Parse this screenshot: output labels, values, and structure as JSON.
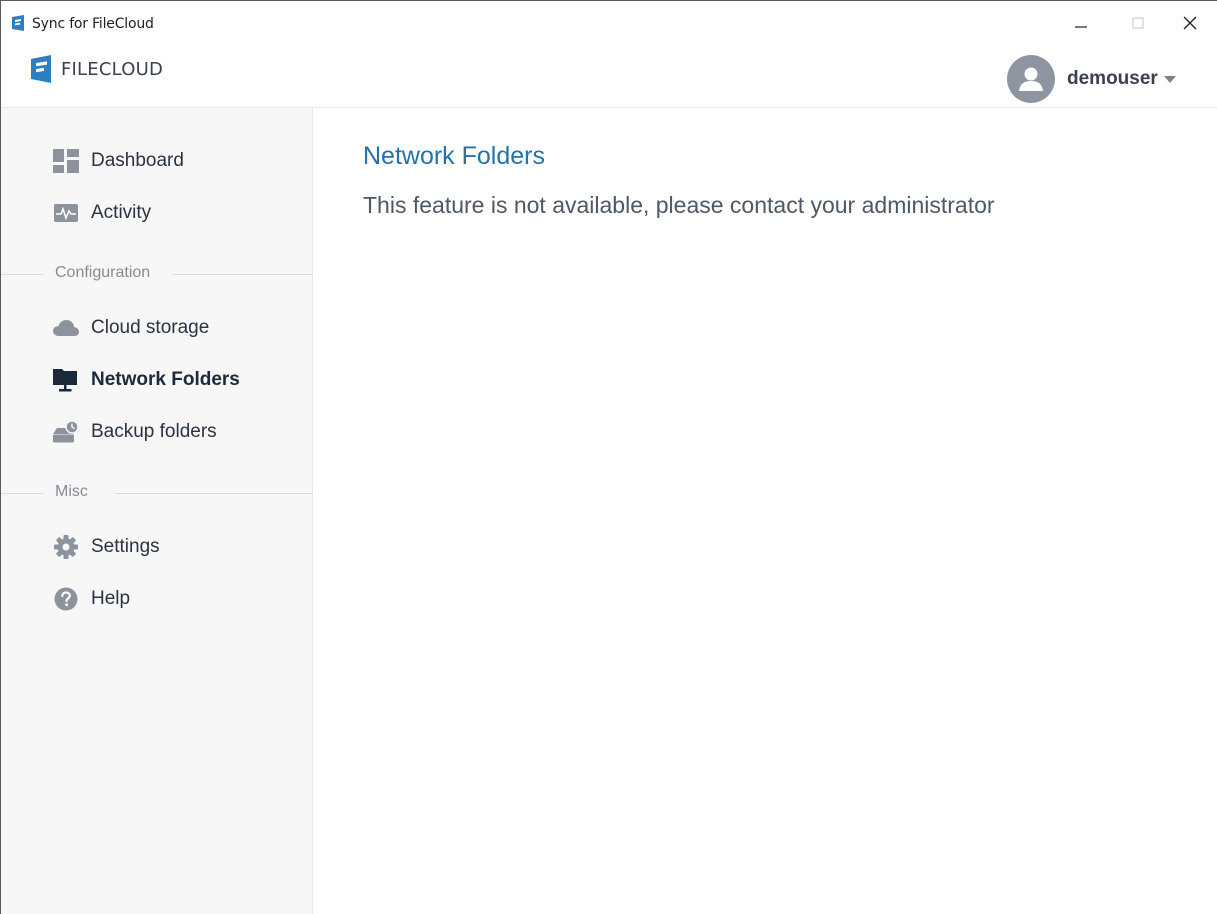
{
  "window": {
    "title": "Sync for FileCloud"
  },
  "header": {
    "brand": "FILECLOUD",
    "username": "demouser"
  },
  "sidebar": {
    "items_top": [
      {
        "label": "Dashboard",
        "icon": "dashboard-icon"
      },
      {
        "label": "Activity",
        "icon": "activity-icon"
      }
    ],
    "section_configuration": "Configuration",
    "items_config": [
      {
        "label": "Cloud storage",
        "icon": "cloud-icon"
      },
      {
        "label": "Network Folders",
        "icon": "network-folder-icon",
        "active": true
      },
      {
        "label": "Backup folders",
        "icon": "backup-icon"
      }
    ],
    "section_misc": "Misc",
    "items_misc": [
      {
        "label": "Settings",
        "icon": "gear-icon"
      },
      {
        "label": "Help",
        "icon": "help-icon"
      }
    ]
  },
  "main": {
    "title": "Network Folders",
    "message": "This feature is not available, please contact your administrator"
  },
  "colors": {
    "accent": "#2472a8",
    "sidebar_bg": "#f7f7f8",
    "brand_blue": "#2d7fc1"
  }
}
